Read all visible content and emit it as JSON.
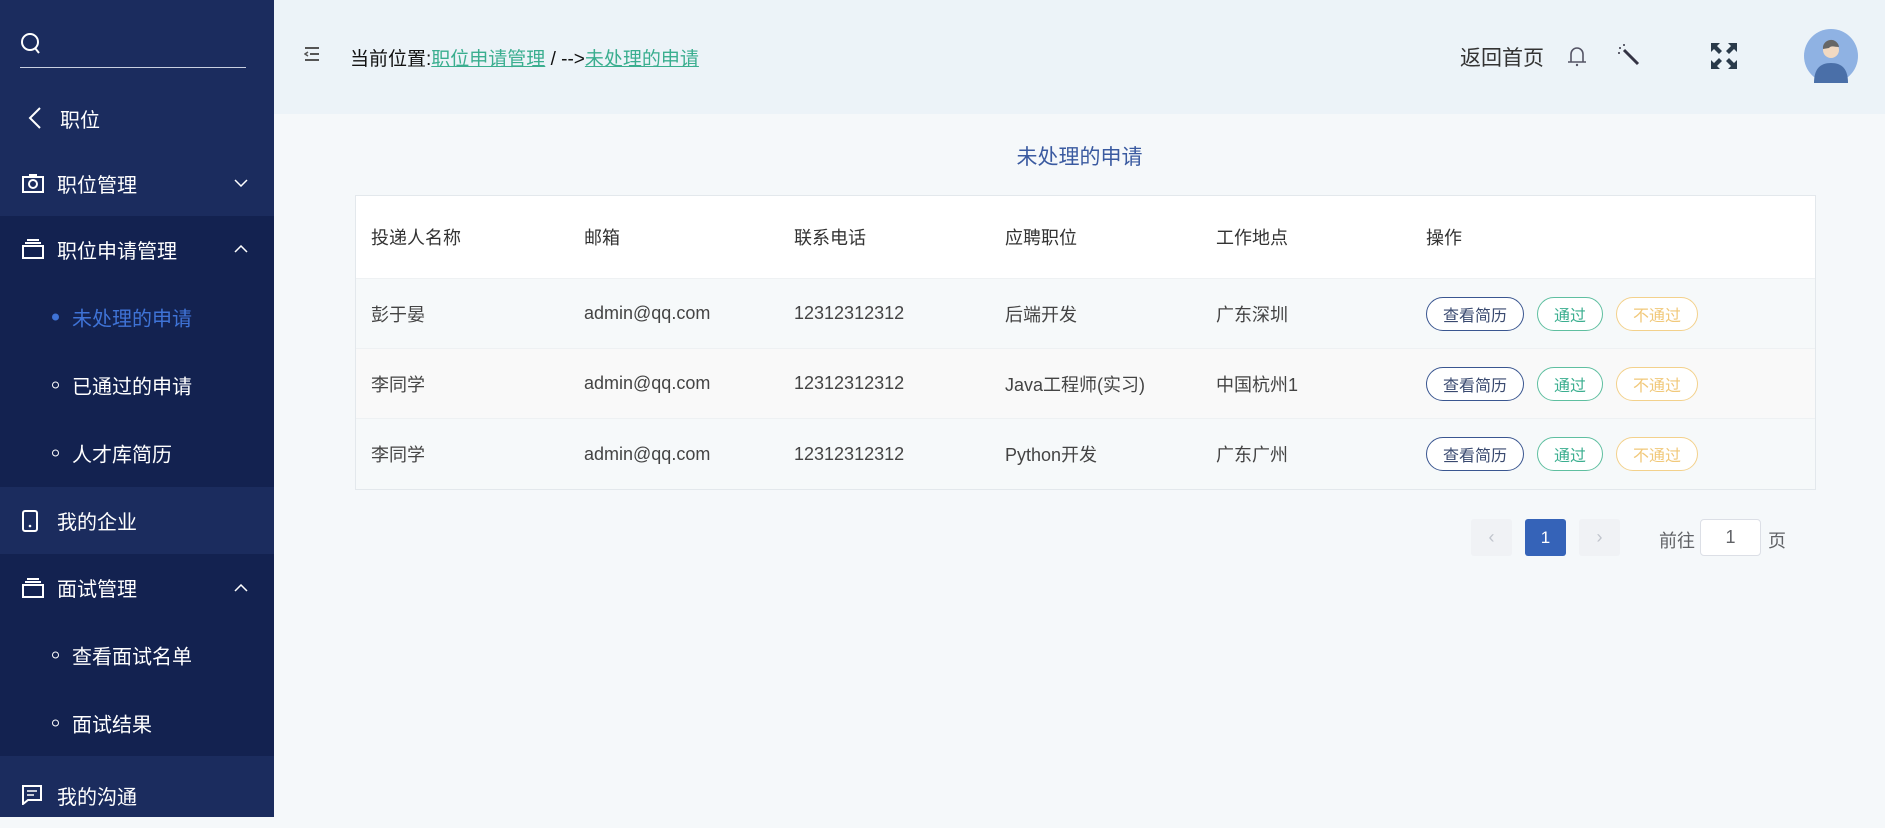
{
  "sidebar": {
    "search_placeholder": "",
    "back_label": "职位",
    "items": [
      {
        "label": "职位管理"
      },
      {
        "label": "职位申请管理",
        "children": [
          {
            "label": "未处理的申请"
          },
          {
            "label": "已通过的申请"
          },
          {
            "label": "人才库简历"
          }
        ]
      },
      {
        "label": "我的企业"
      },
      {
        "label": "面试管理",
        "children": [
          {
            "label": "查看面试名单"
          },
          {
            "label": "面试结果"
          }
        ]
      },
      {
        "label": "我的沟通"
      }
    ]
  },
  "header": {
    "breadcrumb_prefix": "当前位置:",
    "breadcrumb_parent": "职位申请管理",
    "breadcrumb_sep": " / -->",
    "breadcrumb_current": "未处理的申请",
    "home_label": "返回首页"
  },
  "main": {
    "title": "未处理的申请",
    "columns": [
      "投递人名称",
      "邮箱",
      "联系电话",
      "应聘职位",
      "工作地点",
      "操作"
    ],
    "rows": [
      {
        "name": "彭于晏",
        "email": "admin@qq.com",
        "phone": "12312312312",
        "position": "后端开发",
        "location": "广东深圳"
      },
      {
        "name": "李同学",
        "email": "admin@qq.com",
        "phone": "12312312312",
        "position": "Java工程师(实习)",
        "location": "中国杭州1"
      },
      {
        "name": "李同学",
        "email": "admin@qq.com",
        "phone": "12312312312",
        "position": "Python开发",
        "location": "广东广州"
      }
    ],
    "actions": {
      "view": "查看简历",
      "pass": "通过",
      "reject": "不通过"
    },
    "pagination": {
      "current": "1",
      "goto_label": "前往",
      "goto_value": "1",
      "page_suffix": "页"
    }
  }
}
